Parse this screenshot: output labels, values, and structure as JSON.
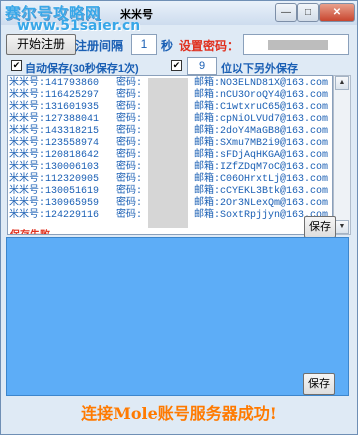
{
  "window": {
    "watermark": "赛尔号攻略网",
    "url_watermark": "www.51saier.cn",
    "title": "米米号",
    "buttons": {
      "minimize": "—",
      "maximize": "□",
      "close": "✕"
    }
  },
  "toolbar": {
    "start_label": "开始注册",
    "interval_label": "注册间隔",
    "interval_value": "1",
    "seconds_label": "秒",
    "password_label": "设置密码："
  },
  "options": {
    "autosave_checked": "✔",
    "autosave_label": "自动保存(30秒保存1次)",
    "digits_checked": "✔",
    "digits_value": "9",
    "digits_label": "位以下另外保存"
  },
  "accounts": [
    {
      "acc": "米米号:141793860",
      "pwd": "密码:",
      "mail": "邮箱:NO3ELND81X@163.com"
    },
    {
      "acc": "米米号:116425297",
      "pwd": "密码:",
      "mail": "邮箱:nCU3OroQY4@163.com"
    },
    {
      "acc": "米米号:131601935",
      "pwd": "密码:",
      "mail": "邮箱:C1wtxruC65@163.com"
    },
    {
      "acc": "米米号:127388041",
      "pwd": "密码:",
      "mail": "邮箱:cpNiOLVUd7@163.com"
    },
    {
      "acc": "米米号:143318215",
      "pwd": "密码:",
      "mail": "邮箱:2doY4MaGB8@163.com"
    },
    {
      "acc": "米米号:123558974",
      "pwd": "密码:",
      "mail": "邮箱:SXmu7MB2i9@163.com"
    },
    {
      "acc": "米米号:120818642",
      "pwd": "密码:",
      "mail": "邮箱:sFDjAqHKGA@163.com"
    },
    {
      "acc": "米米号:130006103",
      "pwd": "密码:",
      "mail": "邮箱:IZfZDqM7oC@163.com"
    },
    {
      "acc": "米米号:112320905",
      "pwd": "密码:",
      "mail": "邮箱:C06OHrxtLj@163.com"
    },
    {
      "acc": "米米号:130051619",
      "pwd": "密码:",
      "mail": "邮箱:cCYEKL3Btk@163.com"
    },
    {
      "acc": "米米号:130965959",
      "pwd": "密码:",
      "mail": "邮箱:2Or3NLexQm@163.com"
    },
    {
      "acc": "米米号:124229116",
      "pwd": "密码:",
      "mail": "邮箱:SoxtRpjjyn@163.com"
    }
  ],
  "list_cut_text": "保存失败",
  "save_button_label": "保存",
  "save_button2_label": "保存",
  "status_text": "连接Mole账号服务器成功!",
  "colors": {
    "accent": "#1a5fb4",
    "red": "#e0301e",
    "log_bg": "#5dadf7",
    "status": "#ff7a00"
  }
}
